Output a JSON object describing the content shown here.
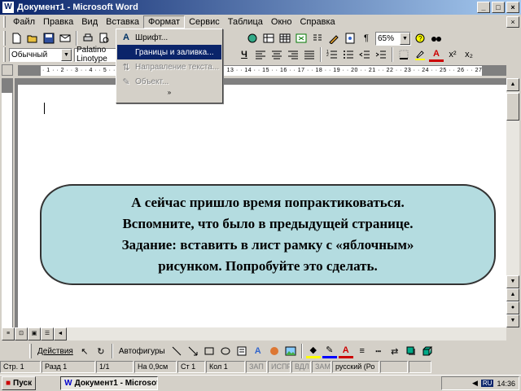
{
  "window": {
    "title": "Документ1 - Microsoft Word",
    "app_icon": "W",
    "minimize": "_",
    "maximize": "□",
    "close": "×"
  },
  "menu": {
    "items": [
      "Файл",
      "Правка",
      "Вид",
      "Вставка",
      "Формат",
      "Сервис",
      "Таблица",
      "Окно",
      "Справка"
    ],
    "active_index": 4
  },
  "toolbar": {
    "zoom": "65%",
    "style": "Обычный",
    "font": "Palatino Linotype"
  },
  "format_menu": {
    "items": [
      {
        "label": "Шрифт...",
        "icon": "font-icon",
        "state": "normal"
      },
      {
        "label": "Границы и заливка...",
        "icon": "borders-icon",
        "state": "selected"
      },
      {
        "label": "Направление текста...",
        "icon": "text-direction-icon",
        "state": "disabled"
      },
      {
        "label": "Объект...",
        "icon": "object-icon",
        "state": "disabled"
      }
    ],
    "expand": "»"
  },
  "ruler": {
    "ticks": "· 1 · · 2 · · 3 · · 4 · · 5 · · 6 · · 7 · · 8 · · 9 · · 10 · · 11 · · 12 · · 13 · · 14 · · 15 · · 16 · · 17 · · 18 · · 19 · · 20 · · 21 · · 22 · · 23 · · 24 · · 25 · · 26 · · 27 · · 28"
  },
  "document": {
    "callout_lines": [
      "А сейчас пришло время попрактиковаться.",
      "Вспомните, что было в предыдущей странице.",
      "Задание: вставить в лист рамку с «яблочным»",
      "рисунком. Попробуйте это сделать."
    ],
    "callout_fill": "#b4dce0"
  },
  "drawing_toolbar": {
    "actions": "Действия",
    "autoshapes": "Автофигуры"
  },
  "status": {
    "page": "Стр. 1",
    "section": "Разд 1",
    "pages": "1/1",
    "position": "На 0,9см",
    "line": "Ст 1",
    "column": "Кол 1",
    "rec": "ЗАП",
    "trk": "ИСПР",
    "ext": "ВДЛ",
    "ovr": "ЗАМ",
    "language": "русский (Ро"
  },
  "taskbar": {
    "start": "Пуск",
    "task": "Документ1 - Microsof...",
    "lang": "RU",
    "time": "14:36"
  }
}
